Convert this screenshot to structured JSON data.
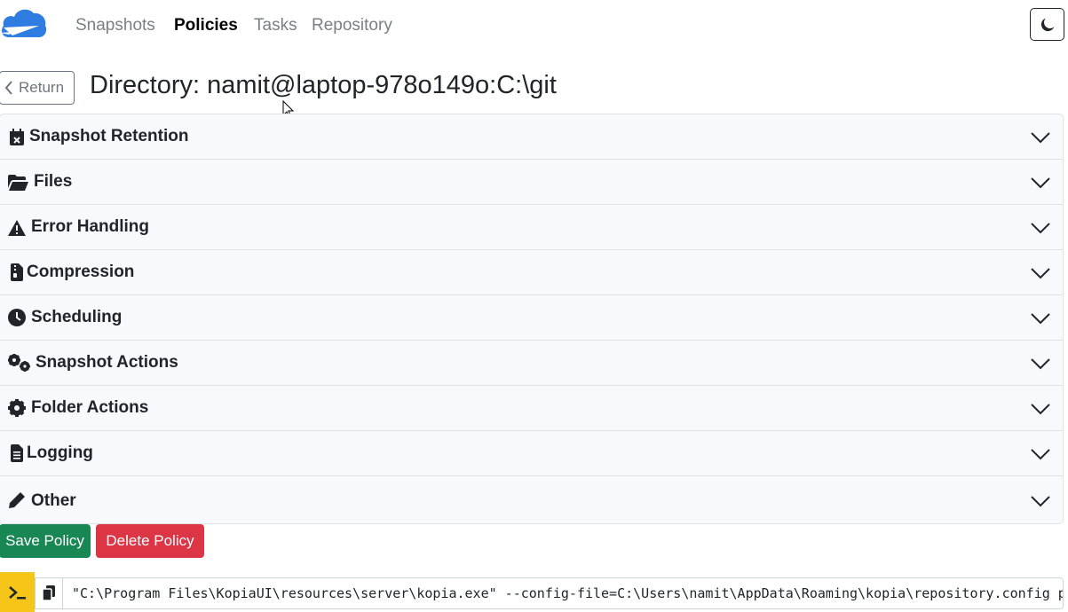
{
  "nav": {
    "items": [
      {
        "label": "Snapshots",
        "active": false
      },
      {
        "label": "Policies",
        "active": true
      },
      {
        "label": "Tasks",
        "active": false
      },
      {
        "label": "Repository",
        "active": false
      }
    ],
    "theme_icon": "moon-icon"
  },
  "header": {
    "return_label": "Return",
    "title": "Directory: namit@laptop-978o149o:C:\\git"
  },
  "sections": [
    {
      "label": "Snapshot Retention",
      "icon": "calendar-x-icon"
    },
    {
      "label": "Files",
      "icon": "folder-open-icon"
    },
    {
      "label": "Error Handling",
      "icon": "warning-icon"
    },
    {
      "label": "Compression",
      "icon": "file-zipper-icon"
    },
    {
      "label": "Scheduling",
      "icon": "clock-icon"
    },
    {
      "label": "Snapshot Actions",
      "icon": "cogs-icon"
    },
    {
      "label": "Folder Actions",
      "icon": "cog-icon"
    },
    {
      "label": "Logging",
      "icon": "file-lines-icon"
    },
    {
      "label": "Other",
      "icon": "pencil-icon"
    }
  ],
  "actions": {
    "save_label": "Save Policy",
    "delete_label": "Delete Policy"
  },
  "cli": {
    "command": "\"C:\\Program Files\\KopiaUI\\resources\\server\\kopia.exe\" --config-file=C:\\Users\\namit\\AppData\\Roaming\\kopia\\repository.config policy set C:\\git"
  },
  "colors": {
    "save": "#198754",
    "delete": "#dc3545",
    "cli_toggle": "#f5c518",
    "accordion_bg": "#f8f9fc"
  }
}
